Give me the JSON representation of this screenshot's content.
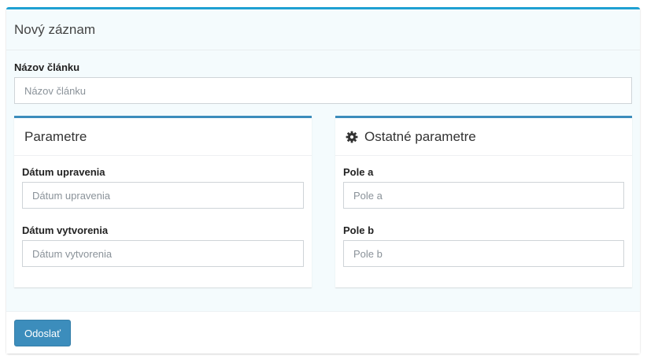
{
  "box": {
    "title": "Nový záznam"
  },
  "article": {
    "label": "Názov článku",
    "placeholder": "Názov článku",
    "value": ""
  },
  "params": {
    "title": "Parametre",
    "modified": {
      "label": "Dátum upravenia",
      "placeholder": "Dátum upravenia",
      "value": ""
    },
    "created": {
      "label": "Dátum vytvorenia",
      "placeholder": "Dátum vytvorenia",
      "value": ""
    }
  },
  "other_params": {
    "title": "Ostatné parametre",
    "icon": "gear-icon",
    "field_a": {
      "label": "Pole a",
      "placeholder": "Pole a",
      "value": ""
    },
    "field_b": {
      "label": "Pole b",
      "placeholder": "Pole b",
      "value": ""
    }
  },
  "footer": {
    "submit_label": "Odoslať"
  },
  "colors": {
    "box_accent": "#1fa0d2",
    "panel_accent": "#3c8dbc",
    "button": "#3c8dbc"
  }
}
